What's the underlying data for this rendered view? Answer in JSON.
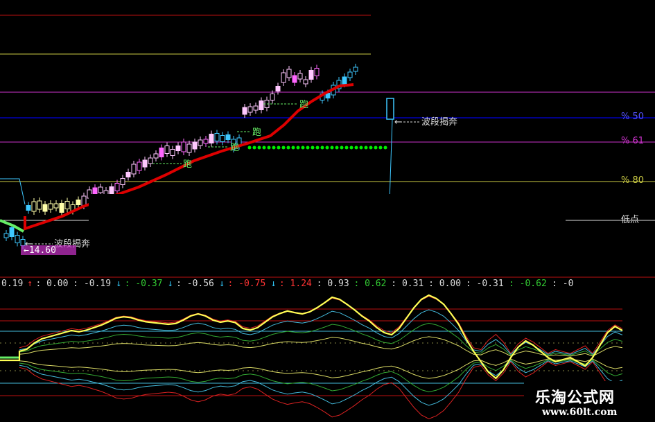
{
  "chart_data": [
    {
      "type": "candlestick",
      "panel": "price",
      "up_colors": [
        "#ffc8ff",
        "#ffffaa"
      ],
      "down_colors": [
        "#3ec8ff",
        "#ff66ff"
      ],
      "pressure_line_color": "#dd0000",
      "support_line_color": "#00ee00",
      "levels": [
        {
          "label": "% 50",
          "color": "#0000dd"
        },
        {
          "label": "% 61",
          "color": "#cc33cc"
        },
        {
          "label": "% 80",
          "color": "#cccc44"
        },
        {
          "label": "低点",
          "color": "#dddddd"
        }
      ],
      "annotations": {
        "wave_label_high": "波段揭奔",
        "wave_label_low": "波段揭奔",
        "low_price": "14.60",
        "run_marks": [
          "跑",
          "跑",
          "跑",
          "跑"
        ]
      }
    },
    {
      "type": "line",
      "panel": "oscillator",
      "scale_labels": [
        {
          "text": "0.19",
          "color": "#dddddd"
        },
        {
          "text": "↑",
          "color": "#ff3333"
        },
        {
          "text": ": 0.00",
          "color": "#dddddd"
        },
        {
          "text": ": -0.19",
          "color": "#dddddd"
        },
        {
          "text": "↓",
          "color": "#33ccff"
        },
        {
          "text": ": -0.37",
          "color": "#33cc33"
        },
        {
          "text": "↓",
          "color": "#33ccff"
        },
        {
          "text": ": -0.56",
          "color": "#dddddd"
        },
        {
          "text": "↓",
          "color": "#33ccff"
        },
        {
          "text": ": -0.75",
          "color": "#ff3333"
        },
        {
          "text": "↓",
          "color": "#33ccff"
        },
        {
          "text": ": 1.24",
          "color": "#ff3333"
        },
        {
          "text": ": 0.93",
          "color": "#dddddd"
        },
        {
          "text": ": 0.62",
          "color": "#33cc33"
        },
        {
          "text": ": 0.31",
          "color": "#dddddd"
        },
        {
          "text": ": 0.00",
          "color": "#dddddd"
        },
        {
          "text": ": -0.31",
          "color": "#dddddd"
        },
        {
          "text": ": -0.62",
          "color": "#33cc33"
        },
        {
          "text": ": -0",
          "color": "#dddddd"
        }
      ],
      "main_series": [
        0.15,
        0.2,
        0.35,
        0.45,
        0.5,
        0.55,
        0.6,
        0.65,
        0.62,
        0.66,
        0.72,
        0.78,
        0.86,
        0.95,
        0.98,
        0.96,
        0.9,
        0.86,
        0.84,
        0.82,
        0.8,
        0.82,
        0.9,
        1.0,
        1.05,
        1.0,
        0.9,
        0.85,
        0.88,
        0.84,
        0.7,
        0.66,
        0.72,
        0.85,
        0.98,
        1.06,
        1.12,
        1.08,
        1.05,
        1.1,
        1.2,
        1.32,
        1.45,
        1.4,
        1.28,
        1.15,
        1.0,
        0.88,
        0.72,
        0.6,
        0.55,
        0.7,
        0.95,
        1.2,
        1.4,
        1.5,
        1.42,
        1.28,
        1.05,
        0.8,
        0.45,
        0.15,
        -0.1,
        -0.35,
        -0.5,
        -0.3,
        0.0,
        0.25,
        0.4,
        0.3,
        0.15,
        0.0,
        -0.1,
        -0.05,
        0.0,
        -0.1,
        -0.2,
        0.0,
        0.3,
        0.6,
        0.75,
        0.65
      ],
      "main_color": "#ffff55",
      "envelope_colors": [
        "#dd2222",
        "#44bbdd",
        "#33aa33",
        "#dddd66"
      ]
    }
  ],
  "watermark": {
    "title": "乐淘公式网",
    "url": "www.60lt.com"
  }
}
